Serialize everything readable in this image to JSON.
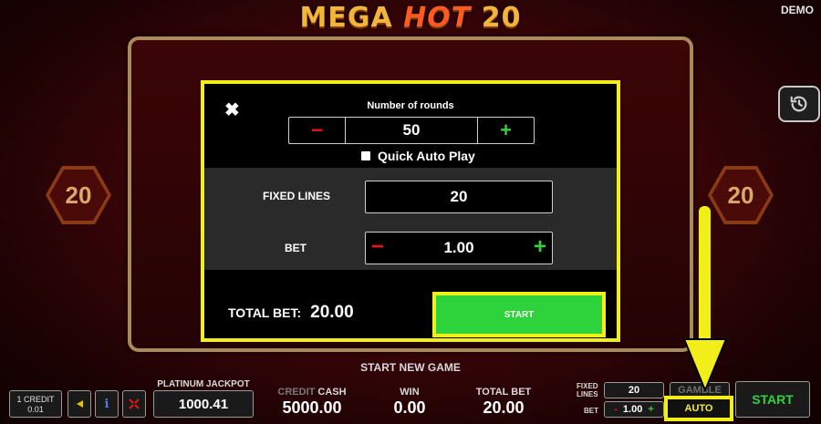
{
  "header": {
    "title_part1": "MEGA ",
    "title_part2": "HOT",
    "title_part3": " 20",
    "mode": "DEMO"
  },
  "reels": {
    "left_badge": "20",
    "right_badge": "20",
    "history_icon": "history-icon"
  },
  "autoplay_dialog": {
    "close_icon": "close-icon",
    "rounds_label": "Number of rounds",
    "rounds_value": "50",
    "minus_symbol": "−",
    "plus_symbol": "+",
    "quick_auto_label": "Quick Auto Play",
    "quick_auto_checked": false,
    "fixed_lines_label": "FIXED LINES",
    "fixed_lines_value": "20",
    "bet_label": "BET",
    "bet_value": "1.00",
    "total_bet_label": "TOTAL BET:",
    "total_bet_value": "20.00",
    "start_label": "START"
  },
  "status": {
    "start_new_game": "START NEW GAME"
  },
  "bottom_bar": {
    "credit_label": "1 CREDIT",
    "credit_value": "0.01",
    "sound_icon": "sound-icon",
    "info_icon": "info-icon",
    "fullscreen_icon": "fullscreen-icon",
    "jackpot_label": "PLATINUM JACKPOT",
    "jackpot_value": "1000.41",
    "credit_word": "CREDIT",
    "cash_word": "CASH",
    "cash_value": "5000.00",
    "win_label": "WIN",
    "win_value": "0.00",
    "total_bet_label": "TOTAL BET",
    "total_bet_value": "20.00",
    "fixed_lines_label": "FIXED\nLINES",
    "fixed_lines_value": "20",
    "bet_label": "BET",
    "bet_minus": "-",
    "bet_value": "1.00",
    "bet_plus": "+",
    "gamble_label": "GAMBLE",
    "auto_label": "AUTO",
    "start_label": "START"
  },
  "colors": {
    "highlight": "#f2ee1a",
    "start_green": "#2ed23a",
    "minus_red": "#e8141b",
    "background": "#3a0508"
  }
}
